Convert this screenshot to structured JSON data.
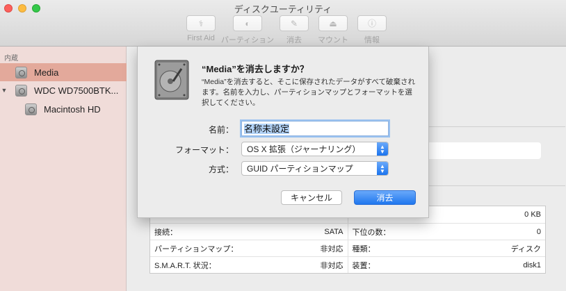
{
  "window": {
    "title": "ディスクユーティリティ"
  },
  "toolbar": [
    {
      "label": "First Aid",
      "icon": "stethoscope-icon",
      "glyph": "⚕"
    },
    {
      "label": "パーティション",
      "icon": "pie-chart-icon",
      "glyph": "◐"
    },
    {
      "label": "消去",
      "icon": "erase-icon",
      "glyph": "✎"
    },
    {
      "label": "マウント",
      "icon": "mount-icon",
      "glyph": "⏏"
    },
    {
      "label": "情報",
      "icon": "info-icon",
      "glyph": "ⓘ"
    }
  ],
  "sidebar": {
    "section": "内蔵",
    "items": [
      {
        "label": "Media",
        "selected": true
      },
      {
        "label": "WDC WD7500BTK...",
        "disclosure": "▼"
      },
      {
        "label": "Macintosh HD"
      }
    ]
  },
  "dialog": {
    "title": "“Media”を消去しますか？",
    "message": "“Media”を消去すると、そこに保存されたデータがすべて破棄されます。名前を入力し、パーティションマップとフォーマットを選択してください。",
    "name_label": "名前：",
    "name_value": "名称未設定",
    "format_label": "フォーマット：",
    "format_value": "OS X 拡張（ジャーナリング）",
    "scheme_label": "方式：",
    "scheme_value": "GUID パーティションマップ",
    "cancel_label": "キャンセル",
    "erase_label": "消去"
  },
  "info": {
    "rows": [
      [
        {
          "label": "",
          "value": ""
        },
        {
          "label": "",
          "value": "0 KB"
        }
      ],
      [
        {
          "label": "接続：",
          "value": "SATA"
        },
        {
          "label": "下位の数：",
          "value": "0"
        }
      ],
      [
        {
          "label": "パーティションマップ：",
          "value": "非対応"
        },
        {
          "label": "種類：",
          "value": "ディスク"
        }
      ],
      [
        {
          "label": "S.M.A.R.T. 状況：",
          "value": "非対応"
        },
        {
          "label": "装置：",
          "value": "disk1"
        }
      ]
    ]
  },
  "colors": {
    "sidebar_bg": "#f0dcd9",
    "selected_bg": "#e3a99b",
    "accent": "#1f76ee"
  }
}
